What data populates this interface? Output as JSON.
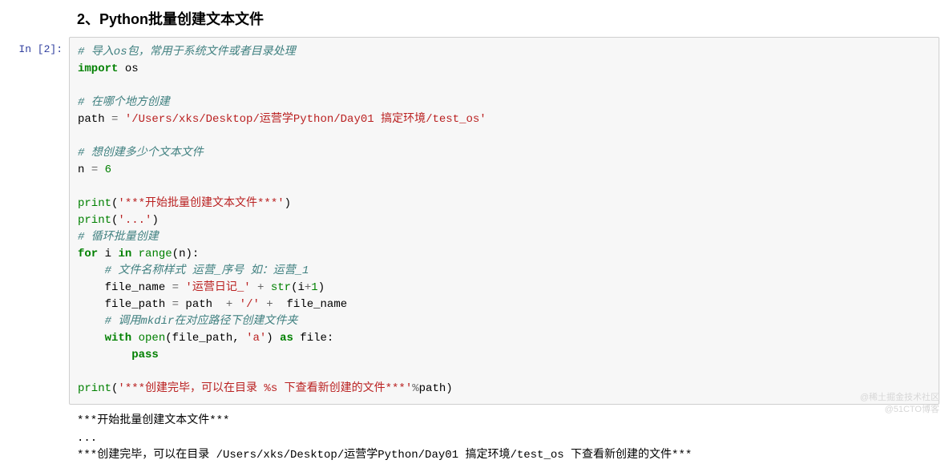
{
  "heading": "2、Python批量创建文本文件",
  "prompt": "In [2]:",
  "code": {
    "c1": "# 导入os包，常用于系统文件或者目录处理",
    "kw_import": "import",
    "mod_os": " os",
    "c2": "# 在哪个地方创建",
    "var_path": "path ",
    "eq": "=",
    "str_path": " '/Users/xks/Desktop/运营学Python/Day01 搞定环境/test_os'",
    "c3": "# 想创建多少个文本文件",
    "var_n": "n ",
    "num_6": " 6",
    "print1_a": "print",
    "print1_b": "(",
    "print1_s": "'***开始批量创建文本文件***'",
    "print1_c": ")",
    "print2_a": "print",
    "print2_b": "(",
    "print2_s": "'...'",
    "print2_c": ")",
    "c4": "# 循环批量创建",
    "kw_for": "for",
    "loop_i": " i ",
    "kw_in": "in",
    "range_a": " range",
    "range_b": "(n):",
    "c5": "    # 文件名称样式 运营_序号 如：运营_1",
    "fname_a": "    file_name ",
    "fname_s": " '运营日记_'",
    "fname_plus": " + ",
    "fname_str": "str",
    "fname_b": "(i",
    "fname_plus2": "+",
    "fname_num1": "1",
    "fname_c": ")",
    "fpath_a": "    file_path ",
    "fpath_b": " path ",
    "fpath_s": "'/'",
    "fpath_c": " file_name",
    "c6": "    # 调用mkdir在对应路径下创建文件夹",
    "kw_with": "    with",
    "open_a": " open",
    "open_b": "(file_path, ",
    "open_s": "'a'",
    "open_c": ") ",
    "kw_as": "as",
    "open_d": " file:",
    "kw_pass": "        pass",
    "print3_a": "print",
    "print3_b": "(",
    "print3_s": "'***创建完毕，可以在目录 %s 下查看新创建的文件***'",
    "print3_op": "%",
    "print3_c": "path)"
  },
  "output": {
    "line1": "***开始批量创建文本文件***",
    "line2": "...",
    "line3": "***创建完毕，可以在目录 /Users/xks/Desktop/运营学Python/Day01 搞定环境/test_os 下查看新创建的文件***"
  },
  "watermark": {
    "l1": "@稀土掘金技术社区",
    "l2": "@51CTO博客"
  }
}
